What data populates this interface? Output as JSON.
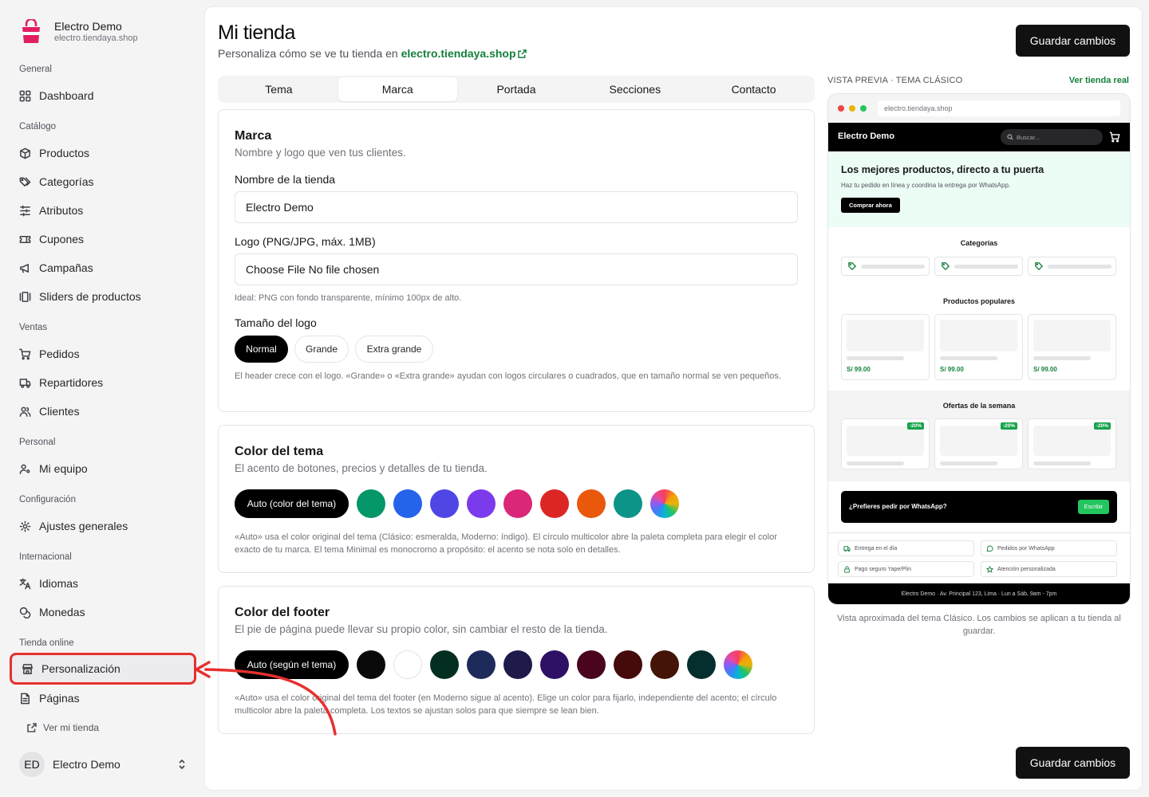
{
  "sidebar": {
    "brand_name": "Electro Demo",
    "brand_url": "electro.tiendaya.shop",
    "groups": {
      "general": "General",
      "catalogo": "Catálogo",
      "ventas": "Ventas",
      "personal": "Personal",
      "configuracion": "Configuración",
      "internacional": "Internacional",
      "tienda_online": "Tienda online"
    },
    "items": {
      "dashboard": "Dashboard",
      "productos": "Productos",
      "categorias": "Categorías",
      "atributos": "Atributos",
      "cupones": "Cupones",
      "campanas": "Campañas",
      "sliders": "Sliders de productos",
      "pedidos": "Pedidos",
      "repartidores": "Repartidores",
      "clientes": "Clientes",
      "mi_equipo": "Mi equipo",
      "ajustes": "Ajustes generales",
      "idiomas": "Idiomas",
      "monedas": "Monedas",
      "personalizacion": "Personalización",
      "paginas": "Páginas",
      "ver_tienda": "Ver mi tienda"
    },
    "user": {
      "initials": "ED",
      "name": "Electro Demo"
    }
  },
  "header": {
    "title": "Mi tienda",
    "subtitle_prefix": "Personaliza cómo se ve tu tienda en",
    "store_link": "electro.tiendaya.shop",
    "save_label": "Guardar cambios"
  },
  "tabs": [
    "Tema",
    "Marca",
    "Portada",
    "Secciones",
    "Contacto"
  ],
  "active_tab": "Marca",
  "marca": {
    "title": "Marca",
    "desc": "Nombre y logo que ven tus clientes.",
    "name_label": "Nombre de la tienda",
    "name_value": "Electro Demo",
    "logo_label": "Logo (PNG/JPG, máx. 1MB)",
    "file_button": "Choose File",
    "file_status": "No file chosen",
    "logo_hint": "Ideal: PNG con fondo transparente, mínimo 100px de alto.",
    "size_label": "Tamaño del logo",
    "sizes": [
      "Normal",
      "Grande",
      "Extra grande"
    ],
    "selected_size": "Normal",
    "size_hint": "El header crece con el logo. «Grande» o «Extra grande» ayudan con logos circulares o cuadrados, que en tamaño normal se ven pequeños."
  },
  "theme_color": {
    "title": "Color del tema",
    "desc": "El acento de botones, precios y detalles de tu tienda.",
    "auto_label": "Auto (color del tema)",
    "colors": [
      "#059669",
      "#2563eb",
      "#4f46e5",
      "#7c3aed",
      "#db2777",
      "#dc2626",
      "#ea580c",
      "#0d9488"
    ],
    "hint": "«Auto» usa el color original del tema (Clásico: esmeralda, Moderno: índigo). El círculo multicolor abre la paleta completa para elegir el color exacto de tu marca. El tema Minimal es monocromo a propósito: el acento se nota solo en detalles."
  },
  "footer_color": {
    "title": "Color del footer",
    "desc": "El pie de página puede llevar su propio color, sin cambiar el resto de la tienda.",
    "auto_label": "Auto (según el tema)",
    "colors": [
      "#0a0a0a",
      "#ffffff",
      "#052e22",
      "#1e2a5a",
      "#1e1b4b",
      "#2e1065",
      "#4a0420",
      "#450a0a",
      "#431407",
      "#042f2e"
    ],
    "hint": "«Auto» usa el color original del tema del footer (en Moderno sigue al acento). Elige un color para fijarlo, independiente del acento; el círculo multicolor abre la paleta completa. Los textos se ajustan solos para que siempre se lean bien."
  },
  "preview": {
    "label": "VISTA PREVIA · TEMA CLÁSICO",
    "link": "Ver tienda real",
    "url": "electro.tiendaya.shop",
    "brand": "Electro Demo",
    "search_placeholder": "Buscar...",
    "hero_title": "Los mejores productos, directo a tu puerta",
    "hero_sub": "Haz tu pedido en línea y coordina la entrega por WhatsApp.",
    "hero_btn": "Comprar ahora",
    "categories_title": "Categorías",
    "popular_title": "Productos populares",
    "prices": [
      "S/ 99.00",
      "S/ 99.00",
      "S/ 99.00"
    ],
    "offers_title": "Ofertas de la semana",
    "badges": [
      "-20%",
      "-20%",
      "-20%"
    ],
    "wa_text": "¿Prefieres pedir por WhatsApp?",
    "wa_btn": "Escribir",
    "features": [
      "Entrega en el día",
      "Pedidos por WhatsApp",
      "Pago seguro Yape/Plin",
      "Atención personalizada"
    ],
    "footer": "Electro Demo · Av. Principal 123, Lima · Lun a Sáb, 9am - 7pm",
    "caption": "Vista aproximada del tema Clásico. Los cambios se aplican a tu tienda al guardar."
  }
}
